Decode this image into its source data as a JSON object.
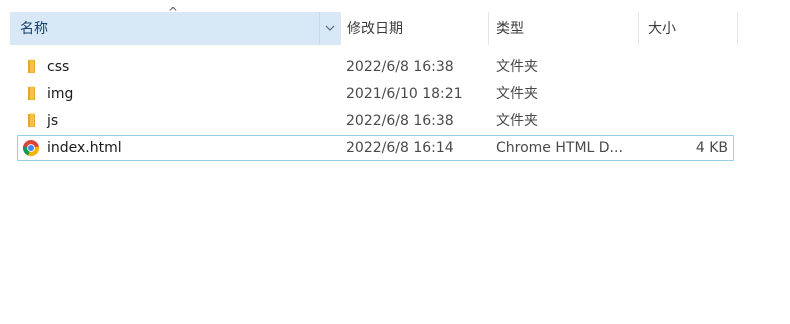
{
  "header": {
    "name": "名称",
    "sort_arrow": "^",
    "date": "修改日期",
    "type": "类型",
    "size": "大小"
  },
  "files": [
    {
      "name": "css",
      "date": "2022/6/8 16:38",
      "type": "文件夹",
      "size": "",
      "icon": "folder-icon"
    },
    {
      "name": "img",
      "date": "2021/6/10 18:21",
      "type": "文件夹",
      "size": "",
      "icon": "folder-icon"
    },
    {
      "name": "js",
      "date": "2022/6/8 16:38",
      "type": "文件夹",
      "size": "",
      "icon": "folder-icon"
    },
    {
      "name": "index.html",
      "date": "2022/6/8 16:14",
      "type": "Chrome HTML D...",
      "size": "4 KB",
      "icon": "chrome-icon",
      "selected": true
    }
  ],
  "colors": {
    "header_selected_bg": "#d9e8f7",
    "selection_border": "#99d1e8",
    "folder": "#f3c24b"
  }
}
